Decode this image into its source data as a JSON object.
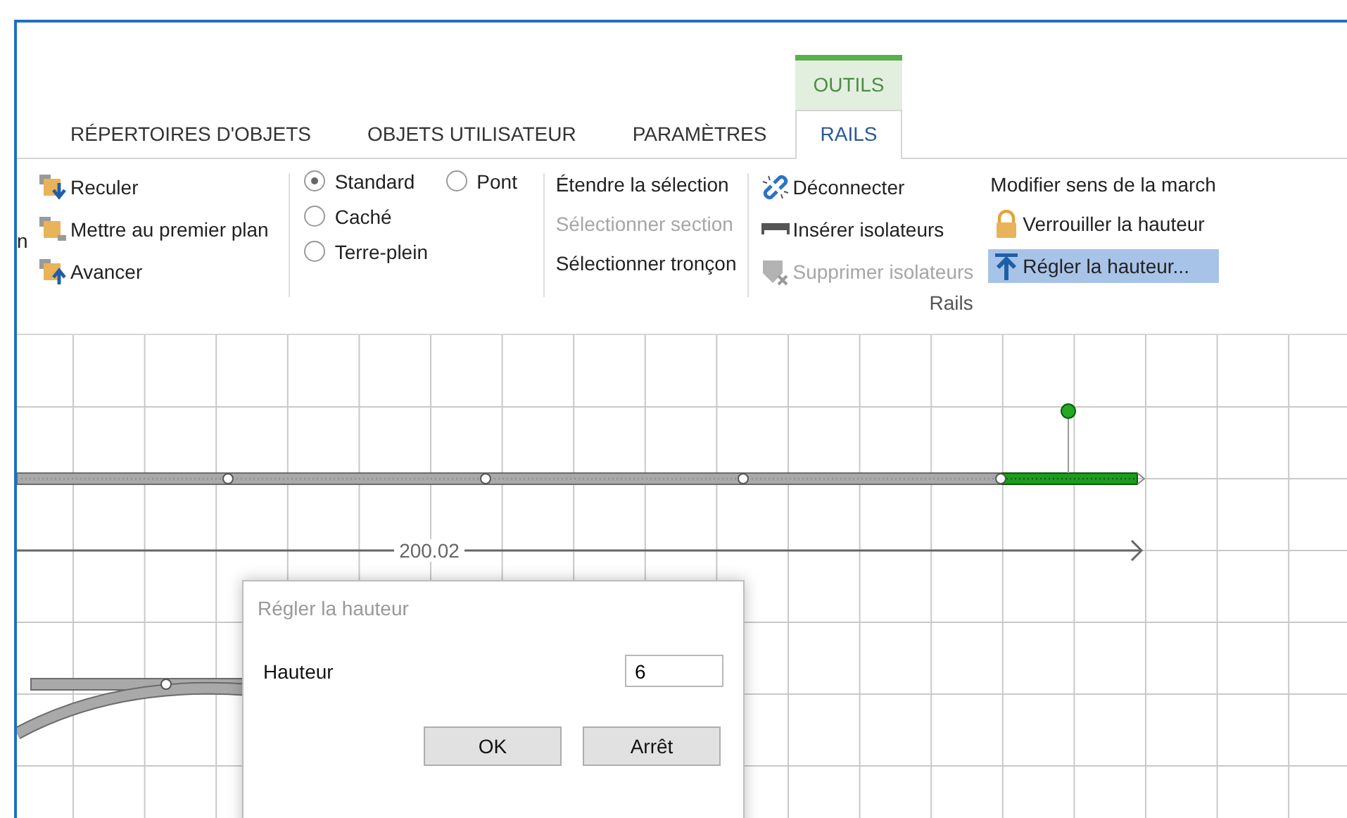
{
  "tabs": [
    {
      "label": "RÉPERTOIRES D'OBJETS",
      "selected": false
    },
    {
      "label": "OBJETS UTILISATEUR",
      "selected": false
    },
    {
      "label": "PARAMÈTRES",
      "selected": false
    },
    {
      "label": "RAILS",
      "selected": true,
      "context": "OUTILS"
    }
  ],
  "ribbon": {
    "edge_text": "n",
    "arrange": [
      {
        "label": "Reculer"
      },
      {
        "label": "Mettre au premier plan"
      },
      {
        "label": "Avancer"
      }
    ],
    "styles": [
      [
        {
          "label": "Standard",
          "selected": true
        },
        {
          "label": "Pont",
          "selected": false
        }
      ],
      [
        {
          "label": "Caché",
          "selected": false
        }
      ],
      [
        {
          "label": "Terre-plein",
          "selected": false
        }
      ]
    ],
    "selection": [
      {
        "label": "Étendre la sélection",
        "disabled": false
      },
      {
        "label": "Sélectionner section",
        "disabled": true
      },
      {
        "label": "Sélectionner tronçon",
        "disabled": false
      }
    ],
    "rail_commands": [
      [
        {
          "label": "Déconnecter",
          "disabled": false,
          "selected": false
        },
        {
          "label": "Insérer isolateurs",
          "disabled": false,
          "selected": false
        },
        {
          "label": "Supprimer isolateurs",
          "disabled": true,
          "selected": false
        }
      ],
      [
        {
          "label": "Modifier sens de la march",
          "disabled": false,
          "selected": false
        },
        {
          "label": "Verrouiller la hauteur",
          "disabled": false,
          "selected": false
        },
        {
          "label": "Régler la hauteur...",
          "disabled": false,
          "selected": true
        }
      ]
    ],
    "group_label": "Rails"
  },
  "canvas": {
    "dimension": "200.02"
  },
  "dialog": {
    "title": "Régler la hauteur",
    "field_label": "Hauteur",
    "value": "6",
    "buttons": [
      "OK",
      "Arrêt"
    ]
  }
}
